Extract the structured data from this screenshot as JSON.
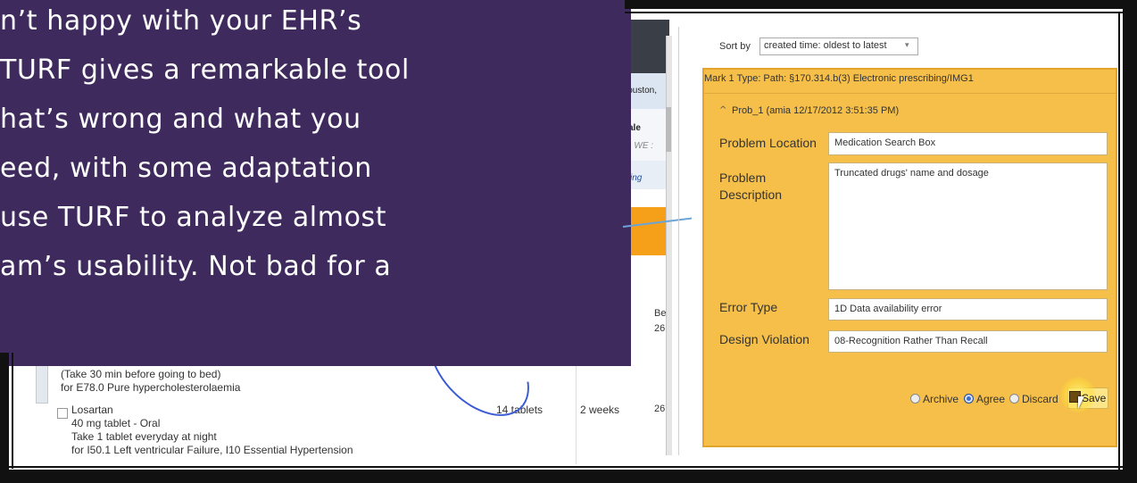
{
  "callout": {
    "lines": [
      "n’t happy with your EHR’s",
      "TURF gives a remarkable tool",
      "hat’s wrong and what you",
      "eed, with some adaptation",
      " use TURF to analyze almost",
      "am’s usability. Not bad for a"
    ]
  },
  "ehr": {
    "fragment_houston": "Houston,",
    "fragment_ale": "ale",
    "fragment_we": "y| WE :",
    "fragment_king": "king",
    "col_be": "Be",
    "row1_col_val": "26",
    "row2_col_val": "26",
    "rows": [
      {
        "line1": "(Take 30 min before going to bed)",
        "line2": "for E78.0 Pure hypercholesterolaemia"
      },
      {
        "name": "Losartan",
        "line1": "40 mg tablet - Oral",
        "line2": "Take 1 tablet everyday at night",
        "line3": "for I50.1 Left ventricular Failure, I10 Essential Hypertension",
        "qty": "14 tablets",
        "duration": "2 weeks"
      }
    ]
  },
  "panel": {
    "sort_label": "Sort by",
    "sort_value": "created time: oldest to latest",
    "mark_title": "Mark 1 Type: Path: §170.314.b(3) Electronic prescribing/IMG1",
    "prob_header": "Prob_1  (amia  12/17/2012 3:51:35 PM)",
    "fields": {
      "problem_location_label": "Problem Location",
      "problem_location_value": "Medication Search Box",
      "problem_description_label_1": "Problem",
      "problem_description_label_2": "Description",
      "problem_description_value": "Truncated drugs' name and dosage",
      "error_type_label": "Error Type",
      "error_type_value": "1D Data availability error",
      "design_violation_label": "Design Violation",
      "design_violation_value": "08-Recognition Rather Than Recall"
    },
    "radios": {
      "archive": "Archive",
      "agree": "Agree",
      "discard": "Discard",
      "selected": "agree"
    },
    "save_label": "Save"
  },
  "colors": {
    "callout_bg": "#3f2a5e",
    "mark_bg": "#f5bf4a",
    "arrow": "#6aa4d8",
    "ehr_orange": "#f6a01a"
  }
}
